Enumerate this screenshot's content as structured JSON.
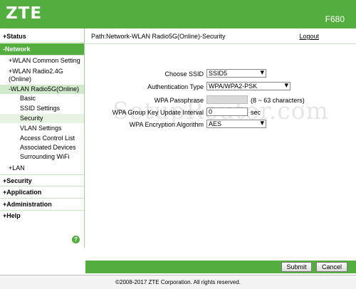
{
  "header": {
    "logo": "ZTE",
    "model": "F680"
  },
  "path": "Path:Network-WLAN Radio5G(Online)-Security",
  "logout": "Logout",
  "nav": {
    "status": "+Status",
    "network": "-Network",
    "wlan_common": "+WLAN Common Setting",
    "wlan_24g": "+WLAN Radio2.4G (Online)",
    "wlan_5g": "-WLAN Radio5G(Online)",
    "basic": "Basic",
    "ssid_settings": "SSID Settings",
    "security": "Security",
    "vlan_settings": "VLAN Settings",
    "acl": "Access Control List",
    "associated": "Associated Devices",
    "surrounding": "Surrounding WiFi",
    "lan": "+LAN",
    "security_top": "+Security",
    "application": "+Application",
    "administration": "+Administration",
    "help": "+Help",
    "help_icon": "?"
  },
  "form": {
    "choose_ssid_label": "Choose SSID",
    "choose_ssid_value": "SSID5",
    "auth_type_label": "Authentication Type",
    "auth_type_value": "WPA/WPA2-PSK",
    "passphrase_label": "WPA Passphrase",
    "passphrase_hint": "(8 ~ 63 characters)",
    "group_key_label": "WPA Group Key Update Interval",
    "group_key_value": "0",
    "group_key_unit": "sec",
    "encryption_label": "WPA Encryption Algorithm",
    "encryption_value": "AES"
  },
  "watermark": "SetupRouter.com",
  "buttons": {
    "submit": "Submit",
    "cancel": "Cancel"
  },
  "footer": "©2008-2017 ZTE Corporation. All rights reserved.",
  "colors": {
    "accent": "#53ad3f"
  }
}
